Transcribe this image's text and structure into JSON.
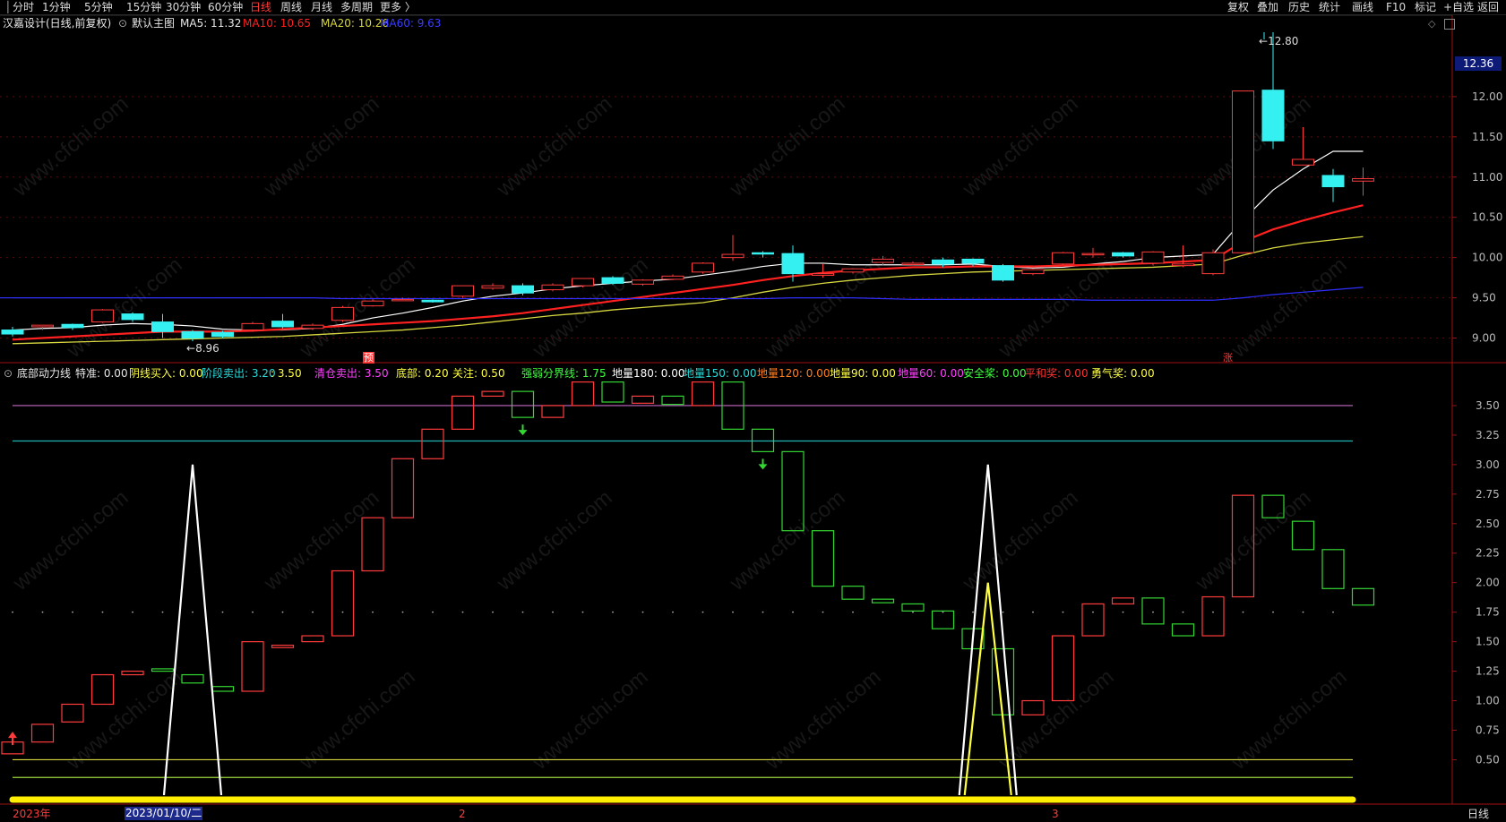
{
  "toolbar": {
    "left_items": [
      "分时",
      "1分钟",
      "5分钟",
      "15分钟",
      "30分钟",
      "60分钟",
      "日线",
      "周线",
      "月线",
      "多周期",
      "更多 〉"
    ],
    "active_index": 6,
    "right_items": [
      "复权",
      "叠加",
      "历史",
      "统计",
      "画线",
      "F10",
      "标记",
      "+自选",
      "返回"
    ]
  },
  "main_chart": {
    "stock_title": "汉嘉设计(日线,前复权)",
    "template_name": "默认主图",
    "ma5": "MA5: 11.32",
    "ma10": "MA10: 10.65",
    "ma20": "MA20: 10.26",
    "ma60": "MA60: 9.63",
    "high_label": "12.80",
    "low_label": "8.96",
    "current_price_tag": "12.36",
    "marker_yu": "预",
    "marker_zhang": "涨",
    "colors": {
      "ma5": "#ffffff",
      "ma10": "#ff2020",
      "ma20": "#d6d640",
      "ma60": "#2f2fff",
      "up": "#ff3b3b",
      "down": "#34f0f0"
    }
  },
  "sub_chart": {
    "indicator_name": "底部动力线",
    "params": [
      {
        "text": "特准: 0.00",
        "color": "#e8e8e8"
      },
      {
        "text": "阴线买入: 0.00",
        "color": "#ffff40"
      },
      {
        "text": "阶段卖出: 3.20",
        "color": "#28d9d9"
      },
      {
        "text": ": 3.50",
        "color": "#ffff40"
      },
      {
        "text": "清仓卖出: 3.50",
        "color": "#ff40ff"
      },
      {
        "text": "底部: 0.20",
        "color": "#ffff40"
      },
      {
        "text": "关注: 0.50",
        "color": "#ffff40"
      },
      {
        "text": "强弱分界线: 1.75",
        "color": "#40ff40"
      },
      {
        "text": "地量180: 0.00",
        "color": "#ffffff"
      },
      {
        "text": "地量150: 0.00",
        "color": "#28d9d9"
      },
      {
        "text": "地量120: 0.00",
        "color": "#ff7f20"
      },
      {
        "text": "地量90: 0.00",
        "color": "#ffff40"
      },
      {
        "text": "地量60: 0.00",
        "color": "#ff40ff"
      },
      {
        "text": "安全桨: 0.00",
        "color": "#40ff40"
      },
      {
        "text": "平和奖: 0.00",
        "color": "#ff3030"
      },
      {
        "text": "勇气奖: 0.00",
        "color": "#ffff40"
      }
    ]
  },
  "x_axis": {
    "year_label": "2023年",
    "selected_date": "2023/01/10/二",
    "month_2": "2",
    "month_3": "3",
    "period_label": "日线"
  },
  "watermark": "www.cfchi.com",
  "chart_data": [
    {
      "type": "candlestick",
      "title": "汉嘉设计(日线,前复权)",
      "ylim": [
        8.75,
        12.9
      ],
      "y_ticks": [
        9.0,
        9.5,
        10.0,
        10.5,
        11.0,
        11.5,
        12.0
      ],
      "candles": [
        [
          9.1,
          9.05,
          9.14,
          9.02
        ],
        [
          9.14,
          9.16,
          9.16,
          9.1
        ],
        [
          9.17,
          9.13,
          9.18,
          9.1
        ],
        [
          9.2,
          9.35,
          9.36,
          9.19
        ],
        [
          9.3,
          9.23,
          9.32,
          9.2
        ],
        [
          9.2,
          9.08,
          9.3,
          9.0
        ],
        [
          9.08,
          9.0,
          9.1,
          8.96
        ],
        [
          9.07,
          9.02,
          9.09,
          9.0
        ],
        [
          9.1,
          9.18,
          9.2,
          9.08
        ],
        [
          9.21,
          9.14,
          9.3,
          9.12
        ],
        [
          9.12,
          9.16,
          9.18,
          9.1
        ],
        [
          9.22,
          9.38,
          9.4,
          9.2
        ],
        [
          9.4,
          9.46,
          9.48,
          9.39
        ],
        [
          9.47,
          9.48,
          9.5,
          9.46
        ],
        [
          9.47,
          9.45,
          9.48,
          9.44
        ],
        [
          9.52,
          9.65,
          9.65,
          9.5
        ],
        [
          9.62,
          9.65,
          9.68,
          9.6
        ],
        [
          9.65,
          9.56,
          9.68,
          9.53
        ],
        [
          9.6,
          9.66,
          9.68,
          9.58
        ],
        [
          9.65,
          9.74,
          9.74,
          9.63
        ],
        [
          9.75,
          9.68,
          9.77,
          9.66
        ],
        [
          9.67,
          9.72,
          9.73,
          9.65
        ],
        [
          9.73,
          9.77,
          9.79,
          9.72
        ],
        [
          9.82,
          9.93,
          9.94,
          9.8
        ],
        [
          10.0,
          10.04,
          10.28,
          9.96
        ],
        [
          10.06,
          10.05,
          10.08,
          10.0
        ],
        [
          10.05,
          9.8,
          10.15,
          9.7
        ],
        [
          9.78,
          9.8,
          9.92,
          9.75
        ],
        [
          9.82,
          9.86,
          9.87,
          9.8
        ],
        [
          9.94,
          9.98,
          10.02,
          9.9
        ],
        [
          9.93,
          9.93,
          9.95,
          9.9
        ],
        [
          9.97,
          9.92,
          10.0,
          9.88
        ],
        [
          9.98,
          9.93,
          9.99,
          9.89
        ],
        [
          9.9,
          9.72,
          9.92,
          9.7
        ],
        [
          9.8,
          9.85,
          9.86,
          9.78
        ],
        [
          9.92,
          10.06,
          10.07,
          9.91
        ],
        [
          10.04,
          10.05,
          10.12,
          10.0
        ],
        [
          10.06,
          10.02,
          10.07,
          10.0
        ],
        [
          9.93,
          10.07,
          10.08,
          9.9
        ],
        [
          9.9,
          9.92,
          10.15,
          9.88
        ],
        [
          9.8,
          10.06,
          10.1,
          9.78
        ],
        [
          10.06,
          12.07,
          12.07,
          10.06
        ],
        [
          12.08,
          11.45,
          12.8,
          11.35
        ],
        [
          11.15,
          11.22,
          11.62,
          11.15
        ],
        [
          11.02,
          10.88,
          11.1,
          10.69
        ],
        [
          10.95,
          10.98,
          11.12,
          10.77
        ]
      ],
      "series": [
        {
          "name": "MA5",
          "values": [
            9.1,
            9.12,
            9.13,
            9.16,
            9.18,
            9.17,
            9.15,
            9.11,
            9.1,
            9.1,
            9.12,
            9.17,
            9.25,
            9.31,
            9.38,
            9.46,
            9.52,
            9.56,
            9.61,
            9.65,
            9.68,
            9.71,
            9.73,
            9.78,
            9.83,
            9.89,
            9.93,
            9.93,
            9.91,
            9.91,
            9.91,
            9.91,
            9.92,
            9.89,
            9.87,
            9.88,
            9.92,
            9.95,
            10.0,
            10.02,
            10.04,
            10.47,
            10.84,
            11.1,
            11.32,
            11.32
          ]
        },
        {
          "name": "MA10",
          "values": [
            8.98,
            9.0,
            9.02,
            9.04,
            9.06,
            9.08,
            9.08,
            9.08,
            9.09,
            9.11,
            9.13,
            9.15,
            9.17,
            9.19,
            9.21,
            9.24,
            9.27,
            9.31,
            9.36,
            9.41,
            9.46,
            9.51,
            9.56,
            9.61,
            9.66,
            9.72,
            9.77,
            9.81,
            9.84,
            9.86,
            9.88,
            9.88,
            9.89,
            9.89,
            9.89,
            9.9,
            9.91,
            9.92,
            9.93,
            9.95,
            9.97,
            10.2,
            10.35,
            10.46,
            10.56,
            10.65
          ]
        },
        {
          "name": "MA20",
          "values": [
            8.93,
            8.94,
            8.95,
            8.96,
            8.97,
            8.98,
            8.99,
            9.0,
            9.01,
            9.02,
            9.04,
            9.06,
            9.08,
            9.1,
            9.13,
            9.16,
            9.2,
            9.24,
            9.28,
            9.31,
            9.35,
            9.38,
            9.41,
            9.44,
            9.5,
            9.57,
            9.63,
            9.68,
            9.72,
            9.75,
            9.78,
            9.8,
            9.82,
            9.83,
            9.84,
            9.85,
            9.86,
            9.87,
            9.88,
            9.9,
            9.92,
            10.03,
            10.12,
            10.18,
            10.22,
            10.26
          ]
        },
        {
          "name": "MA60",
          "values": [
            9.5,
            9.5,
            9.5,
            9.5,
            9.5,
            9.5,
            9.5,
            9.5,
            9.5,
            9.5,
            9.5,
            9.49,
            9.49,
            9.49,
            9.49,
            9.49,
            9.49,
            9.49,
            9.49,
            9.49,
            9.49,
            9.49,
            9.49,
            9.49,
            9.49,
            9.49,
            9.5,
            9.5,
            9.5,
            9.49,
            9.48,
            9.48,
            9.48,
            9.48,
            9.48,
            9.48,
            9.47,
            9.47,
            9.47,
            9.47,
            9.47,
            9.5,
            9.54,
            9.57,
            9.6,
            9.63
          ]
        }
      ]
    },
    {
      "type": "candlestick",
      "title": "底部动力线",
      "ylim": [
        0.2,
        3.75
      ],
      "y_ticks": [
        0.5,
        0.75,
        1.0,
        1.25,
        1.5,
        1.75,
        2.0,
        2.25,
        2.5,
        2.75,
        3.0,
        3.25,
        3.5
      ],
      "reference_lines": [
        3.5,
        3.2,
        1.75,
        0.5,
        0.35
      ],
      "candles": [
        [
          0.55,
          0.65,
          0.65,
          0.55
        ],
        [
          0.65,
          0.8,
          0.8,
          0.65
        ],
        [
          0.82,
          0.97,
          0.97,
          0.82
        ],
        [
          0.97,
          1.22,
          1.22,
          0.97
        ],
        [
          1.22,
          1.25,
          1.25,
          1.22
        ],
        [
          1.27,
          1.25,
          1.27,
          1.25
        ],
        [
          1.22,
          1.15,
          1.22,
          1.15
        ],
        [
          1.12,
          1.08,
          1.12,
          1.08
        ],
        [
          1.08,
          1.5,
          1.5,
          1.08
        ],
        [
          1.45,
          1.47,
          1.47,
          1.45
        ],
        [
          1.5,
          1.55,
          1.55,
          1.5
        ],
        [
          1.55,
          2.1,
          2.1,
          1.55
        ],
        [
          2.1,
          2.55,
          2.55,
          2.1
        ],
        [
          2.55,
          3.05,
          3.05,
          2.55
        ],
        [
          3.05,
          3.3,
          3.3,
          3.05
        ],
        [
          3.3,
          3.58,
          3.58,
          3.3
        ],
        [
          3.58,
          3.62,
          3.62,
          3.58
        ],
        [
          3.62,
          3.4,
          3.62,
          3.4
        ],
        [
          3.4,
          3.5,
          3.5,
          3.4
        ],
        [
          3.5,
          3.7,
          3.7,
          3.5
        ],
        [
          3.7,
          3.53,
          3.7,
          3.53
        ],
        [
          3.52,
          3.58,
          3.58,
          3.52
        ],
        [
          3.58,
          3.51,
          3.58,
          3.51
        ],
        [
          3.5,
          3.7,
          3.7,
          3.5
        ],
        [
          3.7,
          3.3,
          3.7,
          3.3
        ],
        [
          3.3,
          3.11,
          3.3,
          3.11
        ],
        [
          3.11,
          2.44,
          3.11,
          2.44
        ],
        [
          2.44,
          1.97,
          2.44,
          1.97
        ],
        [
          1.97,
          1.86,
          1.97,
          1.86
        ],
        [
          1.86,
          1.83,
          1.86,
          1.83
        ],
        [
          1.82,
          1.76,
          1.82,
          1.76
        ],
        [
          1.76,
          1.61,
          1.76,
          1.61
        ],
        [
          1.61,
          1.44,
          1.61,
          1.44
        ],
        [
          1.44,
          0.88,
          1.44,
          0.88
        ],
        [
          0.88,
          1.0,
          1.0,
          0.88
        ],
        [
          1.0,
          1.55,
          1.55,
          1.0
        ],
        [
          1.55,
          1.82,
          1.82,
          1.55
        ],
        [
          1.82,
          1.87,
          1.87,
          1.82
        ],
        [
          1.87,
          1.65,
          1.87,
          1.65
        ],
        [
          1.65,
          1.55,
          1.65,
          1.55
        ],
        [
          1.55,
          1.88,
          1.88,
          1.55
        ],
        [
          1.88,
          2.74,
          2.74,
          1.88
        ],
        [
          2.74,
          2.55,
          2.74,
          2.55
        ],
        [
          2.52,
          2.28,
          2.52,
          2.28
        ],
        [
          2.28,
          1.95,
          2.28,
          1.95
        ],
        [
          1.95,
          1.81,
          1.95,
          1.81
        ]
      ],
      "spikes": [
        {
          "index": 6,
          "value": 3.0,
          "color": "#ffffff"
        },
        {
          "index": 32.5,
          "value": 3.0,
          "color": "#ffffff"
        },
        {
          "index": 32.5,
          "value": 2.0,
          "color": "#ffff40"
        }
      ],
      "arrows": [
        {
          "index": 0,
          "direction": "up"
        },
        {
          "index": 17,
          "direction": "down"
        },
        {
          "index": 25,
          "direction": "down"
        }
      ]
    }
  ]
}
